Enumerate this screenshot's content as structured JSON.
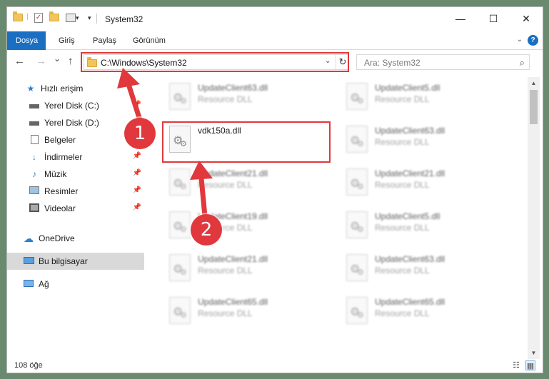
{
  "window": {
    "title": "System32"
  },
  "titlebar": {
    "minimize": "—",
    "maximize": "☐",
    "close": "✕"
  },
  "ribbon": {
    "tabs": [
      "Dosya",
      "Giriş",
      "Paylaş",
      "Görünüm"
    ],
    "help": "?"
  },
  "nav": {
    "back": "←",
    "forward": "→",
    "recent": "⌄",
    "up": "↑",
    "address": "C:\\Windows\\System32",
    "refresh": "↻",
    "search_placeholder": "Ara: System32"
  },
  "sidebar": {
    "items": [
      {
        "label": "Hızlı erişim",
        "icon": "star-icon"
      },
      {
        "label": "Yerel Disk (C:)",
        "icon": "drive-icon",
        "pinned": true
      },
      {
        "label": "Yerel Disk (D:)",
        "icon": "drive-icon",
        "pinned": true
      },
      {
        "label": "Belgeler",
        "icon": "document-icon",
        "pinned": true
      },
      {
        "label": "İndirmeler",
        "icon": "download-icon",
        "pinned": true
      },
      {
        "label": "Müzik",
        "icon": "music-icon",
        "pinned": true
      },
      {
        "label": "Resimler",
        "icon": "pictures-icon",
        "pinned": true
      },
      {
        "label": "Videolar",
        "icon": "video-icon",
        "pinned": true
      },
      {
        "label": "OneDrive",
        "icon": "cloud-icon"
      },
      {
        "label": "Bu bilgisayar",
        "icon": "computer-icon",
        "selected": true
      },
      {
        "label": "Ağ",
        "icon": "network-icon"
      }
    ]
  },
  "files": {
    "left": [
      {
        "name": "UpdateClient63.dll",
        "type": "Resource DLL"
      },
      {
        "name": "vdk150a.dll",
        "type": ""
      },
      {
        "name": "UpdateClient21.dll",
        "type": "Resource DLL"
      },
      {
        "name": "UpdateClient19.dll",
        "type": "Resource DLL"
      },
      {
        "name": "UpdateClient21.dll",
        "type": "Resource DLL"
      },
      {
        "name": "UpdateClient65.dll",
        "type": "Resource DLL"
      }
    ],
    "right": [
      {
        "name": "UpdateClient5.dll",
        "type": "Resource DLL"
      },
      {
        "name": "UpdateClient63.dll",
        "type": "Resource DLL"
      },
      {
        "name": "UpdateClient21.dll",
        "type": "Resource DLL"
      },
      {
        "name": "UpdateClient5.dll",
        "type": "Resource DLL"
      },
      {
        "name": "UpdateClient63.dll",
        "type": "Resource DLL"
      },
      {
        "name": "UpdateClient65.dll",
        "type": "Resource DLL"
      }
    ]
  },
  "status": {
    "count": "108 öğe"
  },
  "annotations": {
    "step1": "1",
    "step2": "2"
  },
  "colors": {
    "accent": "#1a6fc2",
    "annotation": "#e0383c"
  }
}
